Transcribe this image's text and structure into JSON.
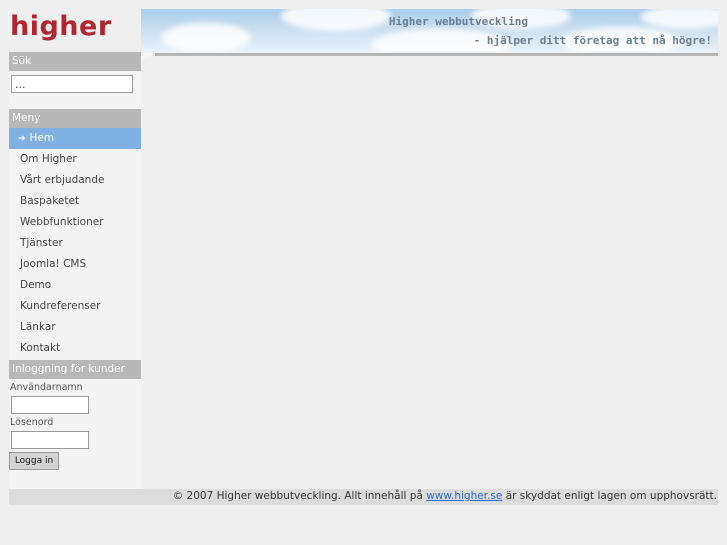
{
  "header": {
    "logo_text": "higher",
    "banner_title": "Higher webbutveckling",
    "banner_subtitle": "- hjälper ditt företag att nå högre!"
  },
  "search": {
    "heading": "Sök",
    "value": "..."
  },
  "menu": {
    "heading": "Meny",
    "active_index": 0,
    "items": [
      {
        "label": "Hem"
      },
      {
        "label": "Om Higher"
      },
      {
        "label": "Vårt erbjudande"
      },
      {
        "label": "Baspaketet"
      },
      {
        "label": "Webbfunktioner"
      },
      {
        "label": "Tjänster"
      },
      {
        "label": "Joomla! CMS"
      },
      {
        "label": "Demo"
      },
      {
        "label": "Kundreferenser"
      },
      {
        "label": "Länkar"
      },
      {
        "label": "Kontakt"
      }
    ]
  },
  "login": {
    "heading": "Inloggning för kunder",
    "username_label": "Användarnamn",
    "password_label": "Lösenord",
    "button_label": "Logga in"
  },
  "footer": {
    "prefix": "© 2007 Higher webbutveckling. Allt innehåll på",
    "link_text": "www.higher.se",
    "suffix": "är skyddat enligt lagen om upphovsrätt."
  },
  "colors": {
    "brand_red": "#b0262e",
    "menu_active": "#7fb0e3",
    "section_header": "#b8b8b8",
    "link": "#2a6bd8"
  }
}
